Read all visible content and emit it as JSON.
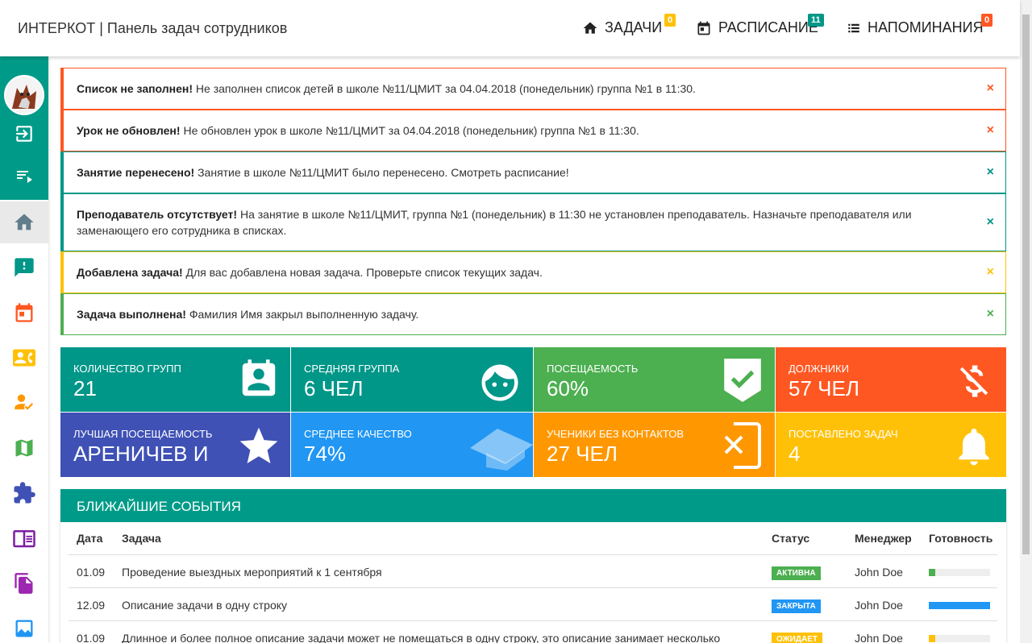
{
  "header": {
    "brand": "ИНТЕРКОТ | Панель задач сотрудников",
    "nav": [
      {
        "label": "ЗАДАЧИ",
        "badge": "0",
        "badge_color": "#ffc107"
      },
      {
        "label": "РАСПИСАНИЕ",
        "badge": "11",
        "badge_color": "#009688"
      },
      {
        "label": "НАПОМИНАНИЯ",
        "badge": "0",
        "badge_color": "#ff5722"
      }
    ]
  },
  "sidebar": {
    "items": [
      "logout-icon",
      "list-icon",
      "home-icon",
      "feedback-icon",
      "calendar-icon",
      "contacts-icon",
      "person-check-icon",
      "map-icon",
      "puzzle-icon",
      "book-icon",
      "documents-icon",
      "chart-icon"
    ]
  },
  "alerts": [
    {
      "title": "Список не заполнен!",
      "text": " Не заполнен список детей в школе №11/ЦМИТ за 04.04.2018 (понедельник) группа №1 в 11:30.",
      "color": "#ff5722"
    },
    {
      "title": "Урок не обновлен!",
      "text": " Не обновлен урок в школе №11/ЦМИТ за 04.04.2018 (понедельник) группа №1 в 11:30.",
      "color": "#ff5722"
    },
    {
      "title": "Занятие перенесено!",
      "text": " Занятие в школе №11/ЦМИТ было перенесено. Смотреть расписание!",
      "color": "#009688"
    },
    {
      "title": "Преподаватель отсутствует!",
      "text": " На занятие в школе №11/ЦМИТ, группа №1 (понедельник) в 11:30 не установлен преподаватель. Назначьте преподавателя или заменающего его сотрудника в списках.",
      "color": "#009688"
    },
    {
      "title": "Добавлена задача!",
      "text": " Для вас добавлена новая задача. Проверьте список текущих задач.",
      "color": "#ffc107"
    },
    {
      "title": "Задача выполнена!",
      "text": " Фамилия Имя закрыл выполненную задачу.",
      "color": "#4caf50"
    }
  ],
  "close_glyph": "×",
  "stats": [
    {
      "label": "Количество групп",
      "value": "21",
      "color": "#009688",
      "icon": "badge-icon"
    },
    {
      "label": "Средняя группа",
      "value": "6 чел",
      "color": "#009688",
      "icon": "face-icon"
    },
    {
      "label": "Посещаемость",
      "value": "60%",
      "color": "#4caf50",
      "icon": "shield-check-icon"
    },
    {
      "label": "Должники",
      "value": "57 чел",
      "color": "#ff5722",
      "icon": "no-money-icon"
    },
    {
      "label": "Лучшая посещаемость",
      "value": "Ареничев И",
      "color": "#3f51b5",
      "icon": "star-icon"
    },
    {
      "label": "Среднее качество",
      "value": "74%",
      "color": "#2196f3",
      "icon": "graduation-icon"
    },
    {
      "label": "Ученики без контактов",
      "value": "27 чел",
      "color": "#ff9800",
      "icon": "no-phone-icon"
    },
    {
      "label": "Поставлено задач",
      "value": "4",
      "color": "#ffc107",
      "icon": "bell-icon"
    }
  ],
  "events": {
    "title": "Ближайшие события",
    "columns": [
      "Дата",
      "Задача",
      "Статус",
      "Менеджер",
      "Готовность"
    ],
    "rows": [
      {
        "date": "01.09",
        "task": "Проведение выездных мероприятий к 1 сентября",
        "status": "Активна",
        "status_color": "#4caf50",
        "manager": "John Doe",
        "progress": 0.1,
        "progress_color": "#4caf50"
      },
      {
        "date": "12.09",
        "task": "Описание задачи в одну строку",
        "status": "Закрыта",
        "status_color": "#2196f3",
        "manager": "John Doe",
        "progress": 1.0,
        "progress_color": "#2196f3"
      },
      {
        "date": "01.09",
        "task": "Длинное и более полное описание задачи может не помещаться в одну строку, это описание занимает несколько",
        "status": "Ожидает",
        "status_color": "#ffc107",
        "manager": "John Doe",
        "progress": 0.1,
        "progress_color": "#ffc107"
      }
    ]
  }
}
